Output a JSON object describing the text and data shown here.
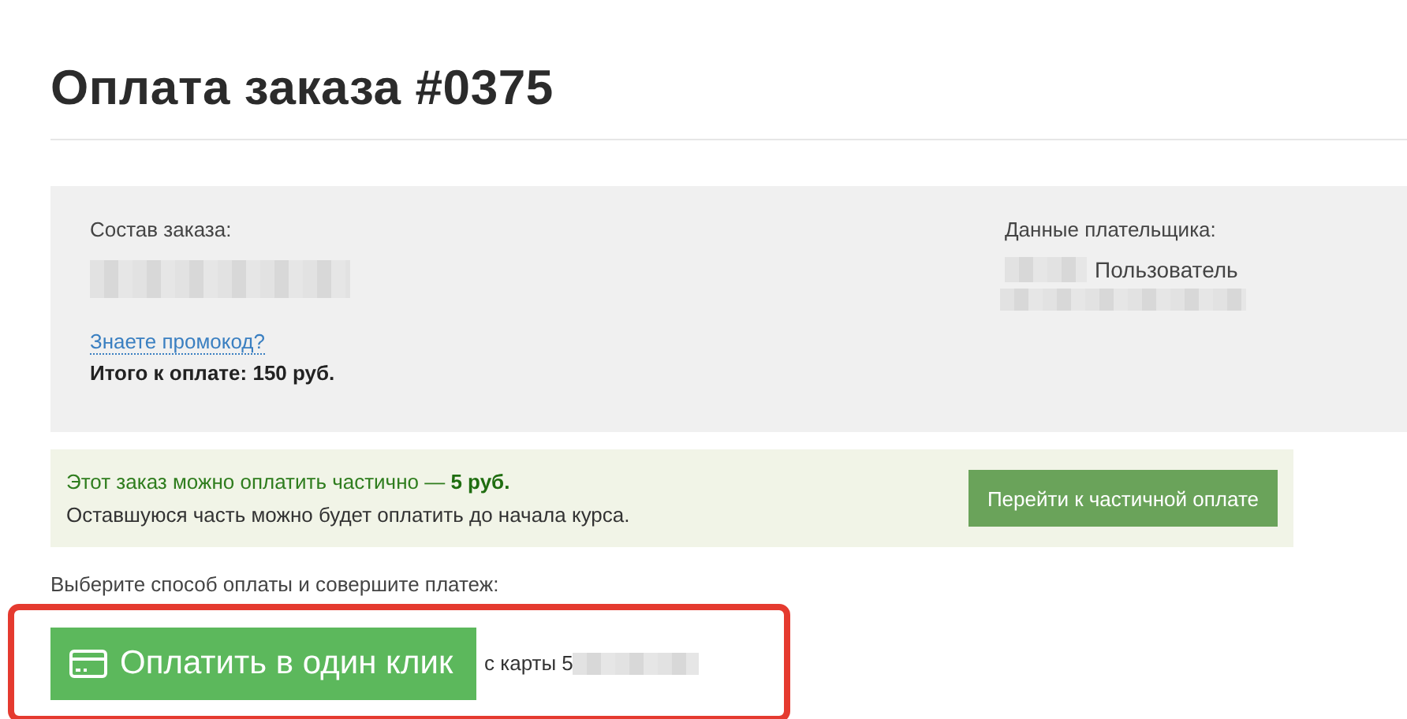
{
  "title": "Оплата заказа #0375",
  "order": {
    "label": "Состав заказа:",
    "promo_link": "Знаете промокод?",
    "total": "Итого к оплате: 150 руб."
  },
  "payer": {
    "label": "Данные плательщика:",
    "name": "Пользователь"
  },
  "partial": {
    "text": "Этот заказ можно оплатить частично — **5 руб.**",
    "note": "Оставшуюся часть можно будет оплатить до начала курса.",
    "button": "Перейти к частичной оплате"
  },
  "payment": {
    "prompt": "Выберите способ оплаты и совершите платеж:",
    "button": "Оплатить в один клик",
    "card": "с карты 5"
  }
}
